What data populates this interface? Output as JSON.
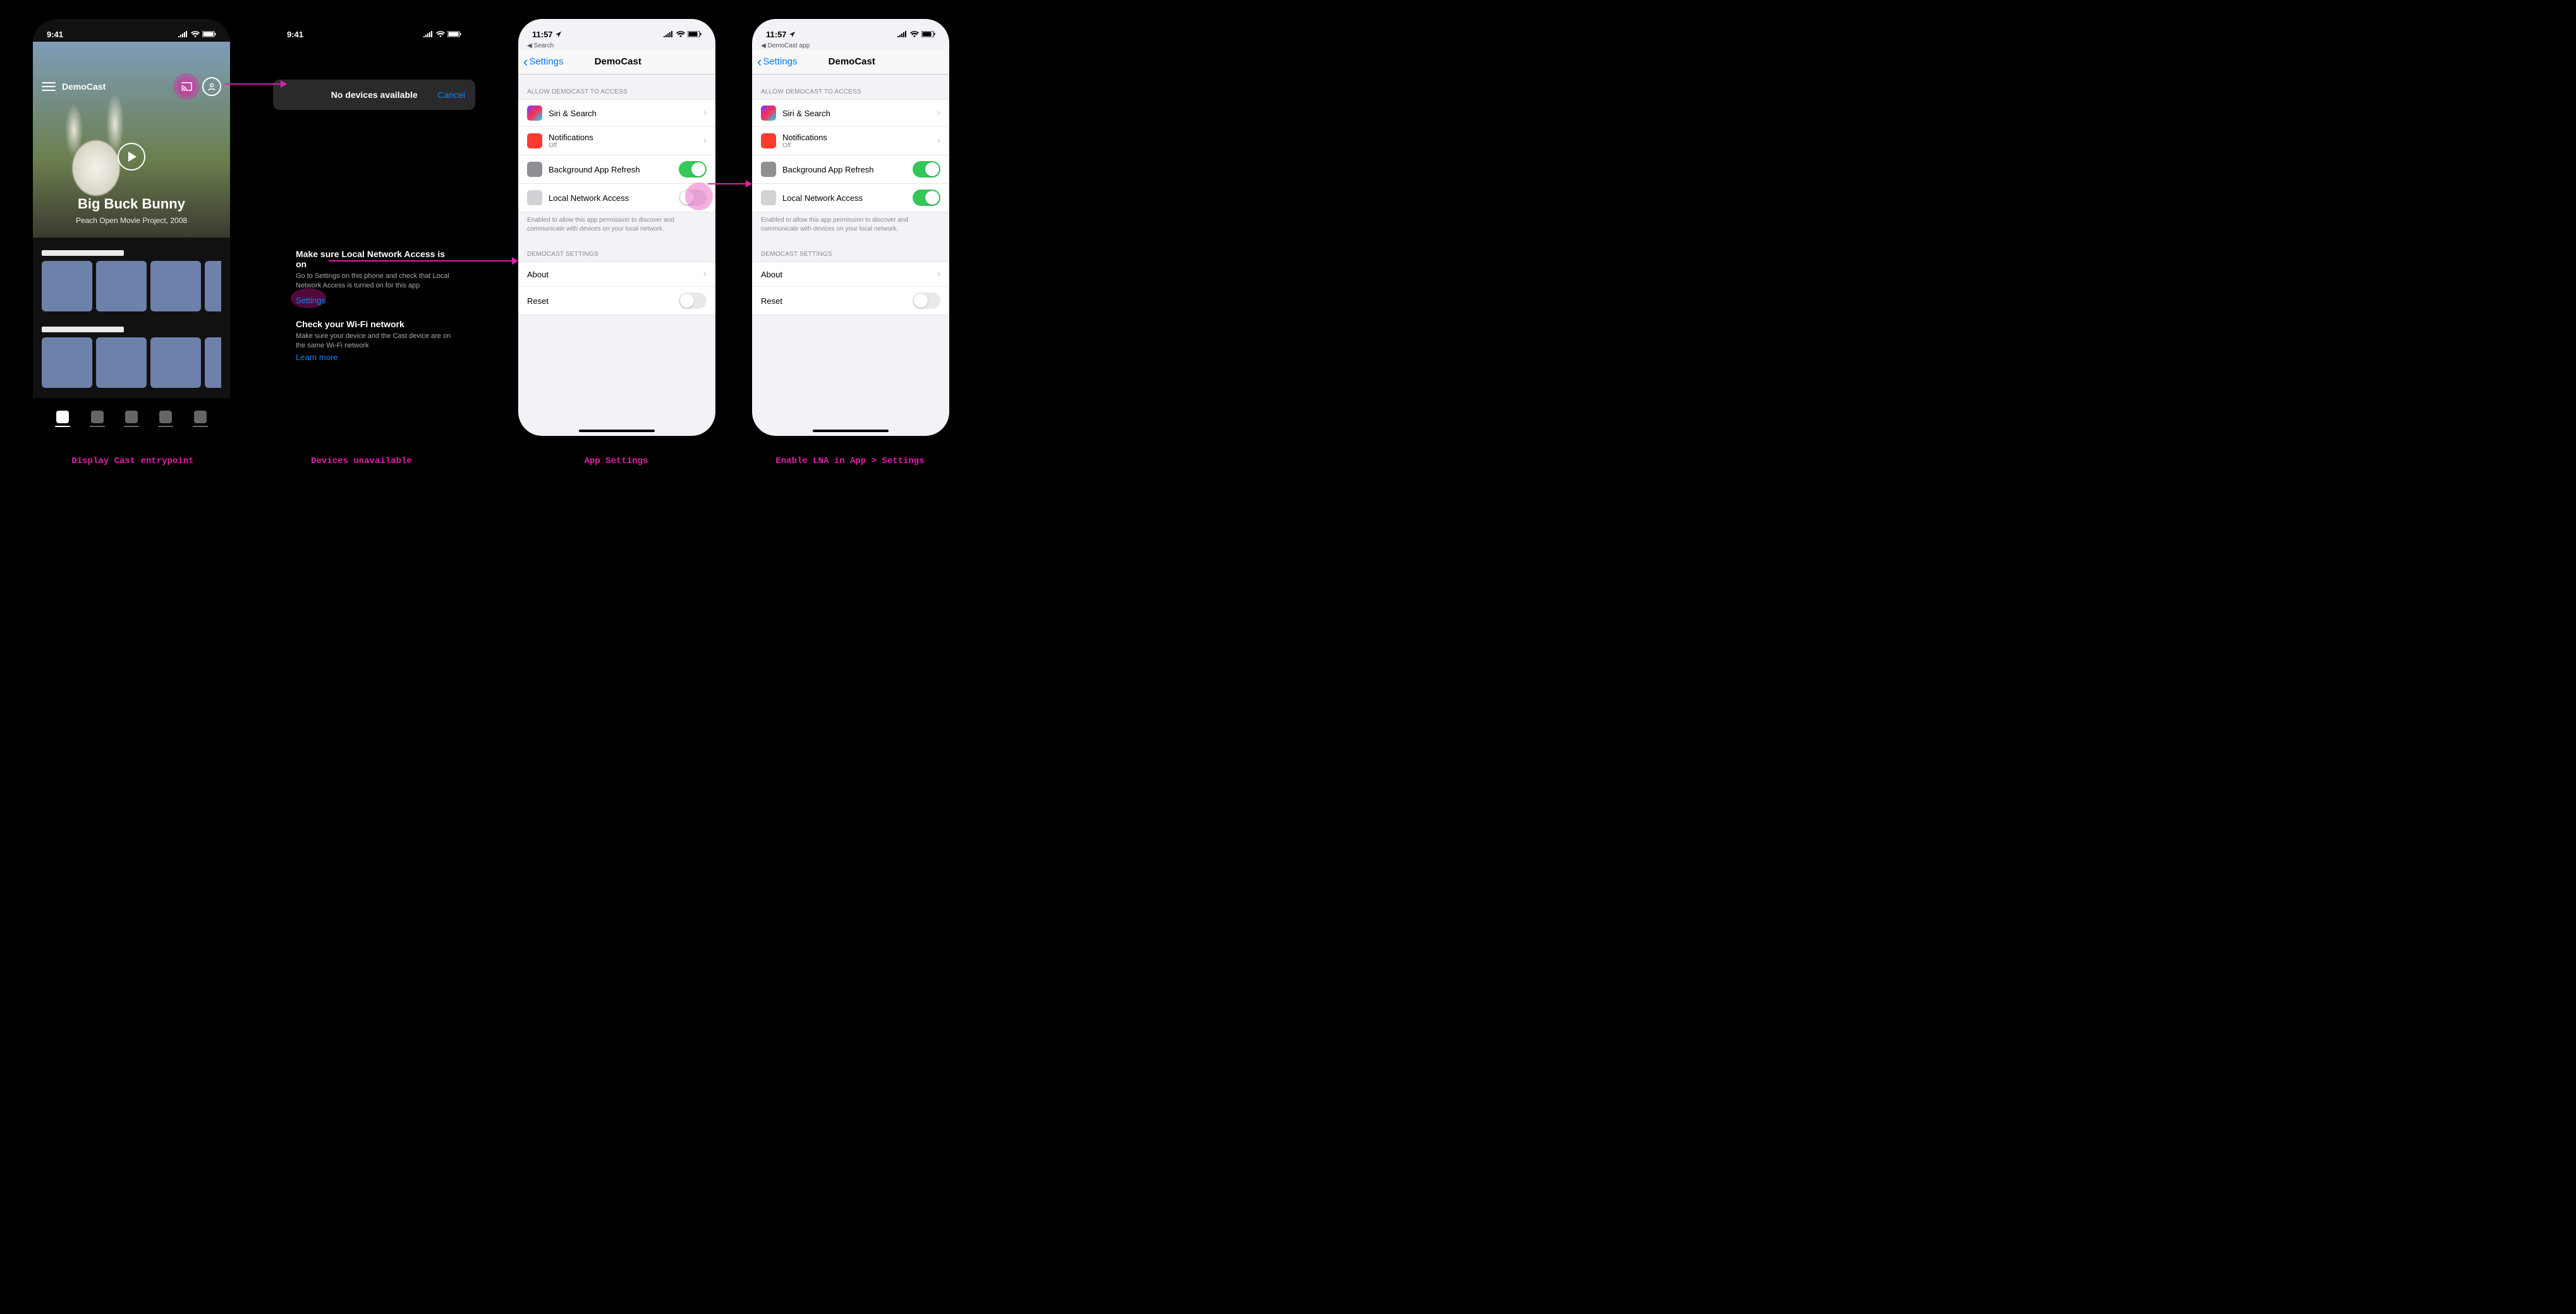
{
  "captions": {
    "a": "Display Cast entrypoint",
    "b": "Devices unavailable",
    "c": "App Settings",
    "d": "Enable LNA in App > Settings"
  },
  "screenA": {
    "time": "9:41",
    "app_name": "DemoCast",
    "hero_title": "Big Buck Bunny",
    "hero_subtitle": "Peach Open Movie Project, 2008"
  },
  "screenB": {
    "time": "9:41",
    "modal_title": "No devices available",
    "cancel": "Cancel",
    "help1_title": "Make sure Local Network Access is on",
    "help1_body": "Go to Settings on this phone and check that Local Network Access is turned on for this app",
    "settings_link": "Settings",
    "help2_title": "Check your Wi-Fi network",
    "help2_body": "Make sure your device and the Cast device are on the same Wi-Fi network",
    "learn_more": "Learn more"
  },
  "settings_common": {
    "time": "11:57",
    "breadcrumb_c": "Search",
    "breadcrumb_d": "DemoCast app",
    "back": "Settings",
    "title": "DemoCast",
    "section1": "ALLOW DEMOCAST TO ACCESS",
    "siri": "Siri & Search",
    "notifications": "Notifications",
    "notifications_sub": "Off",
    "bg_refresh": "Background App Refresh",
    "lna": "Local Network Access",
    "lna_footer": "Enabled to allow this app permission to discover and communicate with devices on your local network.",
    "section2": "DEMOCAST SETTINGS",
    "about": "About",
    "reset": "Reset"
  },
  "colors": {
    "accent": "#e21ea9",
    "ios_blue": "#007aff",
    "ios_green": "#34c759"
  }
}
